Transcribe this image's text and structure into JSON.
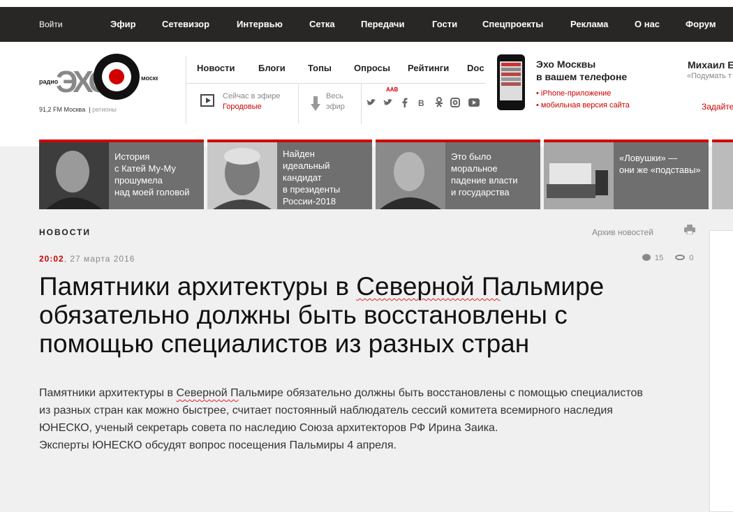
{
  "topnav": {
    "login": "Войти",
    "items": [
      "Эфир",
      "Сетевизор",
      "Интервью",
      "Сетка",
      "Передачи",
      "Гости",
      "Спецпроекты",
      "Реклама",
      "О нас",
      "Форум"
    ]
  },
  "logo": {
    "left": "радио",
    "echo": "ЭХО",
    "right": "москвы",
    "freq": "91,2 FM Москва",
    "regions": "регионы"
  },
  "rubrics": [
    "Новости",
    "Блоги",
    "Топы",
    "Опросы",
    "Рейтинги",
    "Doc"
  ],
  "onair": {
    "label": "Сейчас в эфире",
    "show": "Городовые"
  },
  "allair": {
    "line1": "Весь",
    "line2": "эфир"
  },
  "socials": {
    "aav": "ААВ",
    "icons": [
      "youtube-like-icon",
      "twitter-icon",
      "facebook-icon",
      "vk-icon",
      "odnoklassniki-icon",
      "instagram-icon",
      "youtube-icon"
    ]
  },
  "mobile": {
    "title1": "Эхо Москвы",
    "title2": "в вашем телефоне",
    "links": [
      "iPhone-приложение",
      "мобильная версия сайта"
    ]
  },
  "guest": {
    "name": "Михаил Е",
    "note": "«Подумать т",
    "ask": "Задайте"
  },
  "promo": [
    {
      "text": [
        "История",
        "с Катей Му-Му",
        "прошумела",
        "над моей головой"
      ]
    },
    {
      "text": [
        "Найден",
        "идеальный",
        "кандидат",
        "в президенты",
        "России-2018"
      ]
    },
    {
      "text": [
        "Это было",
        "моральное",
        "падение власти",
        "и государства"
      ]
    },
    {
      "text": [
        "«Ловушки» —",
        "они же «подставы»"
      ]
    }
  ],
  "news": {
    "section": "НОВОСТИ",
    "archive": "Архив новостей",
    "time": "20:02",
    "date": ", 27 марта 2016",
    "comments": "15",
    "views": "0",
    "title_a": "Памятники архитектуры в ",
    "title_u": "Северной П",
    "title_b": "альмире обязательно должны быть восстановлены с помощью специалистов из разных стран",
    "body_a": "Памятники архитектуры в ",
    "body_u": "Северной П",
    "body_b": "альмире обязательно должны быть восстановлены с помощью специалистов из разных стран как можно быстрее, считает постоянный наблюдатель сессий комитета всемирного наследия ЮНЕСКО, ученый секретарь совета по наследию Союза архитекторов РФ Ирина Заика.",
    "body_c": "Эксперты ЮНЕСКО обсудят вопрос посещения Пальмиры 4 апреля."
  }
}
